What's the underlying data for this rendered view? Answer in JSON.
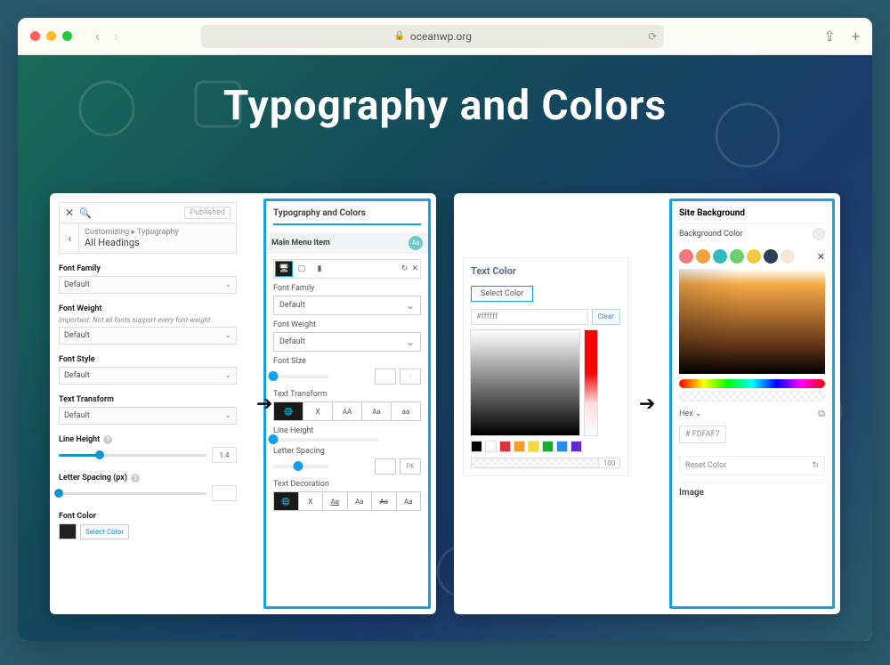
{
  "browser": {
    "url": "oceanwp.org"
  },
  "headline": "Typography and Colors",
  "wp": {
    "published": "Published",
    "breadcrumb_top": "Customizing ▸ Typography",
    "breadcrumb_main": "All Headings",
    "font_family_lbl": "Font Family",
    "font_family_val": "Default",
    "font_weight_lbl": "Font Weight",
    "font_weight_note": "Important: Not all fonts support every font-weight.",
    "font_weight_val": "Default",
    "font_style_lbl": "Font Style",
    "font_style_val": "Default",
    "text_transform_lbl": "Text Transform",
    "text_transform_val": "Default",
    "line_height_lbl": "Line Height",
    "line_height_val": "1.4",
    "letter_spacing_lbl": "Letter Spacing (px)",
    "font_color_lbl": "Font Color",
    "select_color": "Select Color"
  },
  "panel": {
    "title": "Typography and Colors",
    "section": "Main Menu Item",
    "font_family_lbl": "Font Family",
    "font_family_val": "Default",
    "font_weight_lbl": "Font Weight",
    "font_weight_val": "Default",
    "font_size_lbl": "Font Size",
    "text_transform_lbl": "Text Transform",
    "tt_options": [
      "X",
      "AA",
      "Aa",
      "aa"
    ],
    "line_height_lbl": "Line Height",
    "letter_spacing_lbl": "Letter Spacing",
    "letter_spacing_unit": "PX",
    "text_decoration_lbl": "Text Decoration",
    "td_options": [
      "X",
      "Aa",
      "Aa",
      "Aa",
      "Aa"
    ]
  },
  "textcolor": {
    "title": "Text Color",
    "select": "Select Color",
    "hex": "#ffffff",
    "clear": "Clear",
    "opacity": "100",
    "swatches": [
      "#000000",
      "#ffffff",
      "#d63638",
      "#f0a030",
      "#f5d742",
      "#1ea832",
      "#2d8be8",
      "#6229c9"
    ]
  },
  "sitebg": {
    "title": "Site Background",
    "bg_label": "Background Color",
    "presets": [
      "#f07878",
      "#f0a242",
      "#30bcbc",
      "#6fcf6f",
      "#f5c842",
      "#2a4255",
      "#f4e8d8"
    ],
    "hex_lbl": "Hex",
    "hex_val": "FDFAF7",
    "reset": "Reset Color",
    "image": "Image"
  }
}
